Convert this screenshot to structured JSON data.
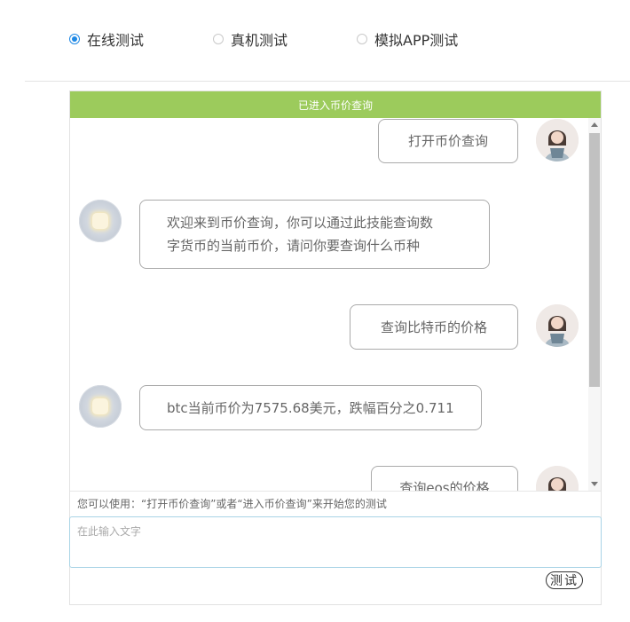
{
  "tabs": [
    {
      "label": "在线测试",
      "selected": true
    },
    {
      "label": "真机测试",
      "selected": false
    },
    {
      "label": "模拟APP测试",
      "selected": false
    }
  ],
  "panel": {
    "header_text": "已进入币价查询",
    "header_color": "#9ccb5c"
  },
  "messages": [
    {
      "role": "user",
      "text": "打开币价查询"
    },
    {
      "role": "bot",
      "lines": [
        "欢迎来到币价查询，你可以通过此技能查询数",
        "字货币的当前币价，请问你要查询什么币种"
      ]
    },
    {
      "role": "user",
      "text": "查询比特币的价格"
    },
    {
      "role": "bot",
      "lines": [
        "btc当前币价为7575.68美元，跌幅百分之0.711"
      ]
    },
    {
      "role": "user",
      "text": "查询eos的价格"
    }
  ],
  "hint": "您可以使用：“打开币价查询”或者“进入币价查询”来开始您的测试",
  "input": {
    "placeholder": "在此输入文字",
    "value": ""
  },
  "test_button": "测试",
  "colors": {
    "accent": "#1e88e5",
    "header": "#9ccb5c",
    "input_border": "#a9d4e6"
  }
}
